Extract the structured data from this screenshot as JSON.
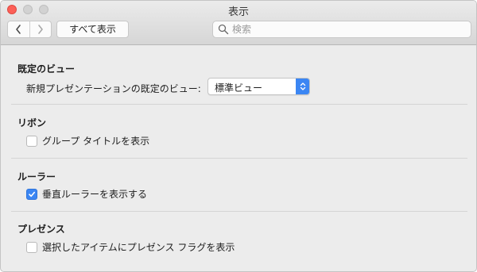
{
  "window": {
    "title": "表示"
  },
  "toolbar": {
    "show_all_label": "すべて表示",
    "search_placeholder": "検索"
  },
  "sections": {
    "default_view": {
      "title": "既定のビュー",
      "label": "新規プレゼンテーションの既定のビュー:",
      "selected_value": "標準ビュー"
    },
    "ribbon": {
      "title": "リボン",
      "option_label": "グループ タイトルを表示",
      "checked": false
    },
    "ruler": {
      "title": "ルーラー",
      "option_label": "垂直ルーラーを表示する",
      "checked": true
    },
    "presence": {
      "title": "プレゼンス",
      "option_label": "選択したアイテムにプレゼンス フラグを表示",
      "checked": false
    }
  },
  "colors": {
    "accent": "#3b86f3",
    "close_button": "#fc5f57"
  },
  "icons": {
    "back": "chevron-left-icon",
    "forward": "chevron-right-icon",
    "search": "search-icon",
    "select": "up-down-arrows-icon",
    "check": "checkmark-icon"
  }
}
